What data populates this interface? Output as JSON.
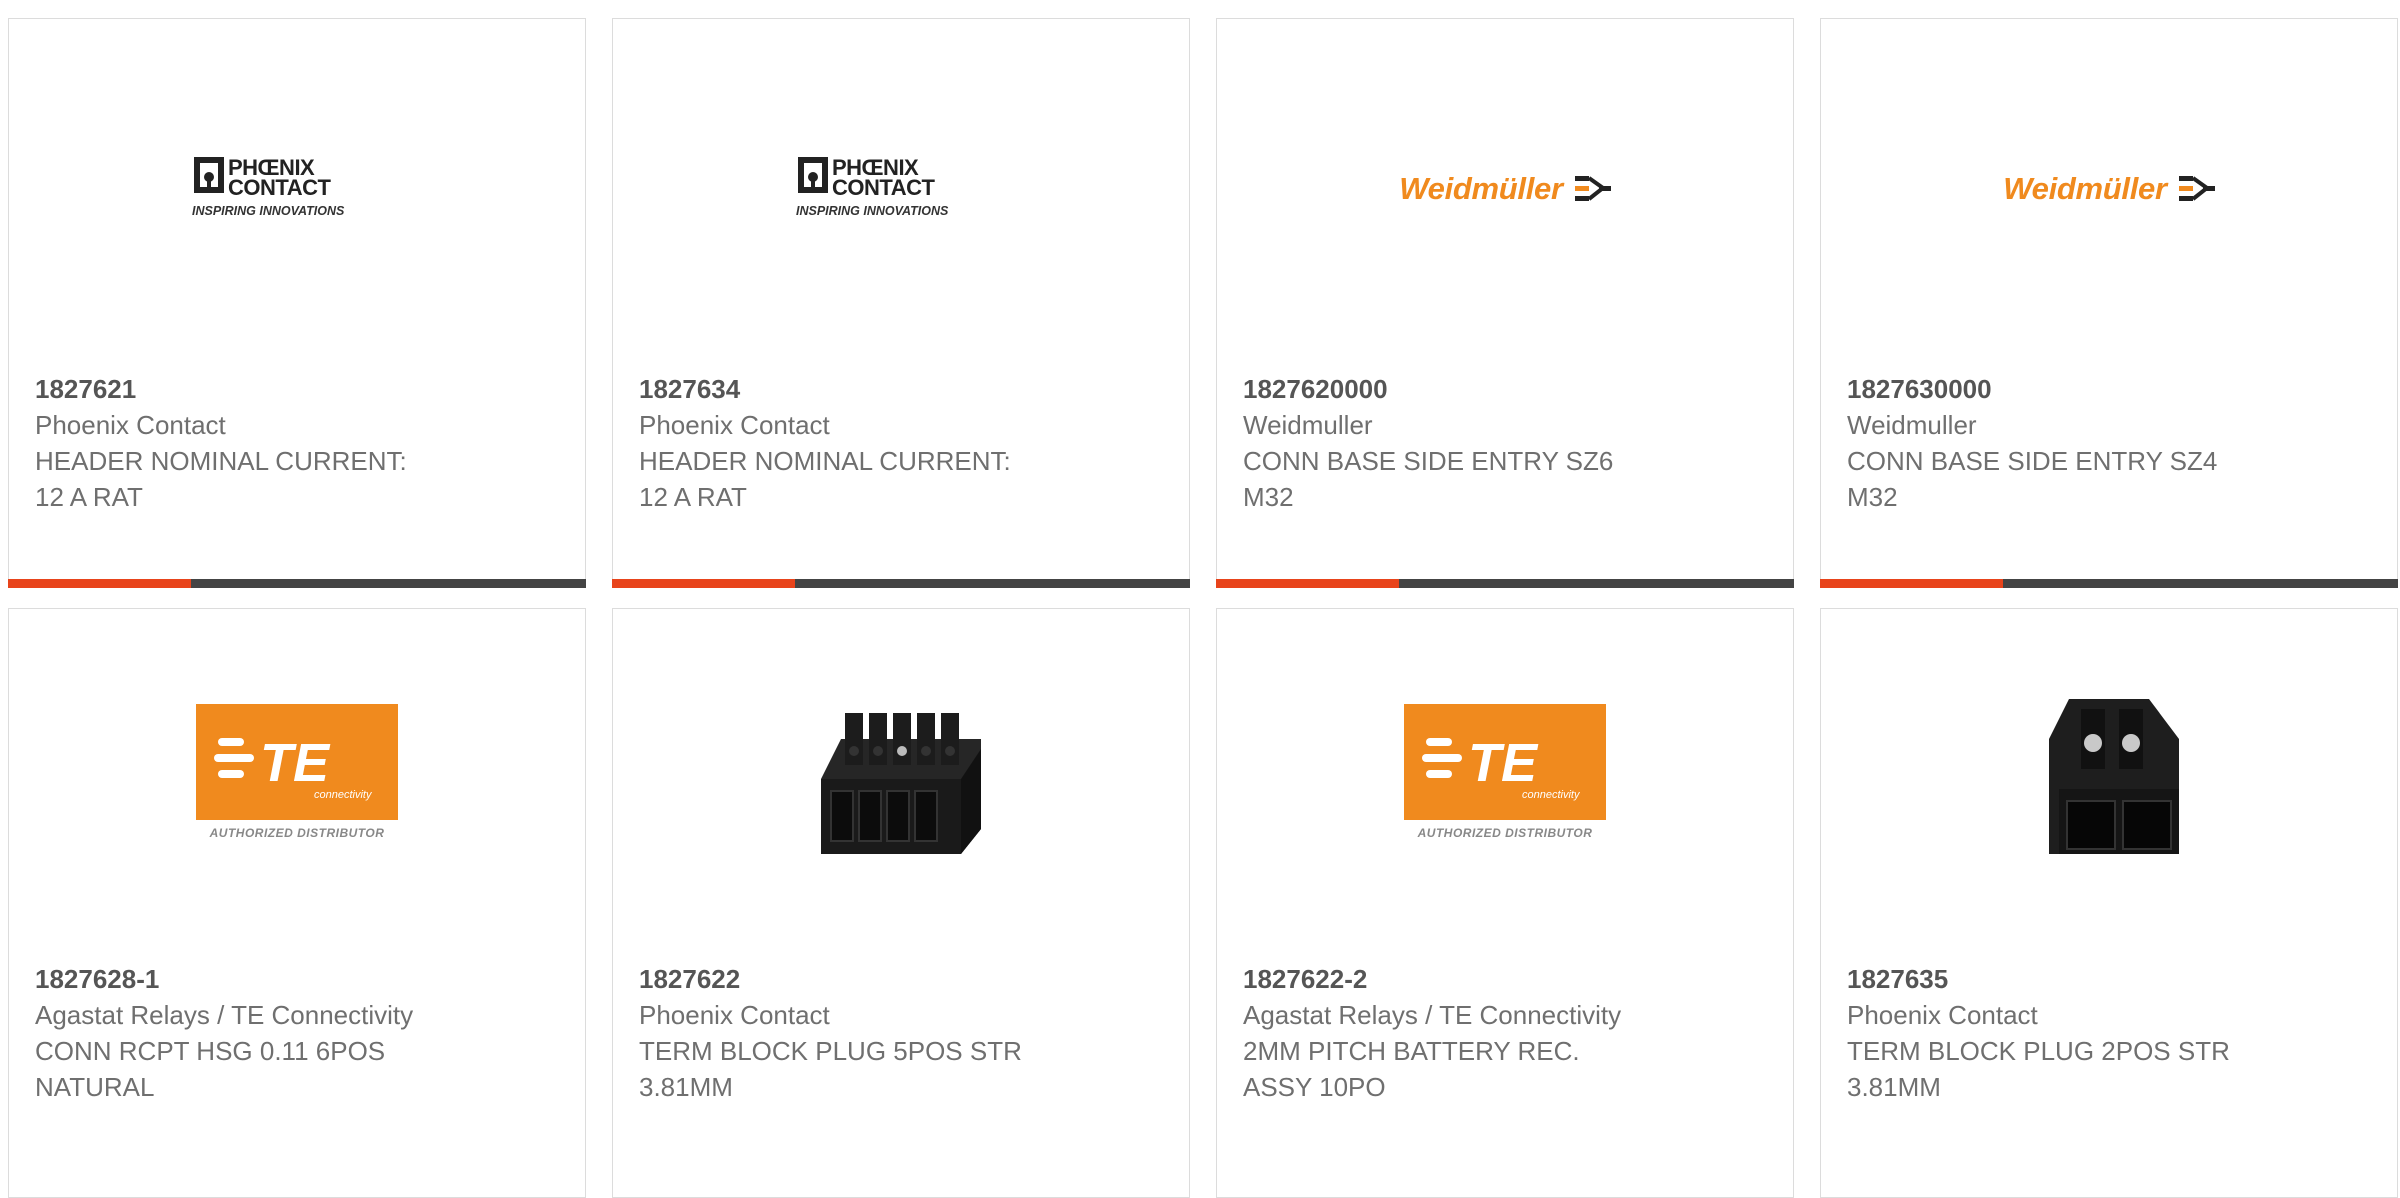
{
  "products": [
    {
      "sku": "1827621",
      "manufacturer": "Phoenix Contact",
      "description": "HEADER NOMINAL CURRENT:\n12 A RAT",
      "image": "phoenix-contact-logo"
    },
    {
      "sku": "1827634",
      "manufacturer": "Phoenix Contact",
      "description": "HEADER NOMINAL CURRENT:\n12 A RAT",
      "image": "phoenix-contact-logo"
    },
    {
      "sku": "1827620000",
      "manufacturer": "Weidmuller",
      "description": "CONN BASE SIDE ENTRY SZ6\nM32",
      "image": "weidmuller-logo"
    },
    {
      "sku": "1827630000",
      "manufacturer": "Weidmuller",
      "description": "CONN BASE SIDE ENTRY SZ4\nM32",
      "image": "weidmuller-logo"
    },
    {
      "sku": "1827628-1",
      "manufacturer": "Agastat Relays / TE Connectivity",
      "description": "CONN RCPT HSG 0.11 6POS\nNATURAL",
      "image": "te-connectivity-logo"
    },
    {
      "sku": "1827622",
      "manufacturer": "Phoenix Contact",
      "description": "TERM BLOCK PLUG 5POS STR\n3.81MM",
      "image": "terminal-block-5pos-photo"
    },
    {
      "sku": "1827622-2",
      "manufacturer": "Agastat Relays / TE Connectivity",
      "description": "2MM PITCH BATTERY REC.\nASSY 10PO",
      "image": "te-connectivity-logo"
    },
    {
      "sku": "1827635",
      "manufacturer": "Phoenix Contact",
      "description": "TERM BLOCK PLUG 2POS STR\n3.81MM",
      "image": "terminal-block-2pos-photo"
    }
  ],
  "logos": {
    "phoenix_line1": "PHŒNIX",
    "phoenix_line2": "CONTACT",
    "phoenix_tagline": "INSPIRING INNOVATIONS",
    "weidmuller_name": "Weidmüller",
    "te_mark": "TE",
    "te_sub": "connectivity",
    "te_tagline": "AUTHORIZED DISTRIBUTOR"
  },
  "colors": {
    "accent": "#e8441b",
    "bar": "#444444",
    "weidmuller_orange": "#f08a1e",
    "te_orange": "#f08a1e"
  }
}
